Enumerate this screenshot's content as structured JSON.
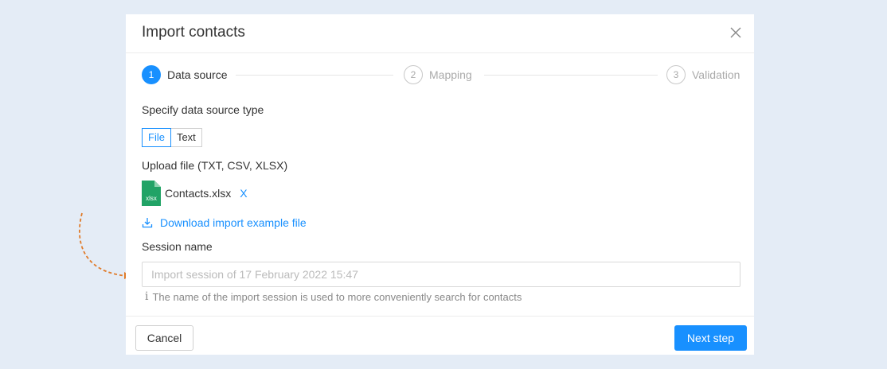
{
  "dialog": {
    "title": "Import contacts"
  },
  "steps": [
    {
      "number": "1",
      "label": "Data source",
      "state": "active"
    },
    {
      "number": "2",
      "label": "Mapping",
      "state": "inactive"
    },
    {
      "number": "3",
      "label": "Validation",
      "state": "inactive"
    }
  ],
  "source_type": {
    "label": "Specify data source type",
    "options": [
      "File",
      "Text"
    ],
    "selected": "File"
  },
  "upload": {
    "label": "Upload file (TXT, CSV, XLSX)",
    "file_name": "Contacts.xlsx",
    "file_icon_text": "xlsx",
    "remove_glyph": "X",
    "download_link": "Download import example file"
  },
  "session": {
    "label": "Session name",
    "placeholder": "Import session of 17 February 2022 15:47",
    "value": "",
    "hint_icon": "i",
    "hint": "The name of the import session is used to more conveniently search for contacts"
  },
  "footer": {
    "cancel_label": "Cancel",
    "next_label": "Next step"
  },
  "colors": {
    "accent": "#1890ff",
    "background": "#e4ecf6",
    "xlsx_icon": "#21a366",
    "annotation_arrow": "#e07b2a"
  },
  "icons": {
    "close": "close-icon",
    "file": "xlsx-file-icon",
    "download": "download-icon",
    "info": "info-icon",
    "annotation": "dashed-arrow-icon"
  }
}
